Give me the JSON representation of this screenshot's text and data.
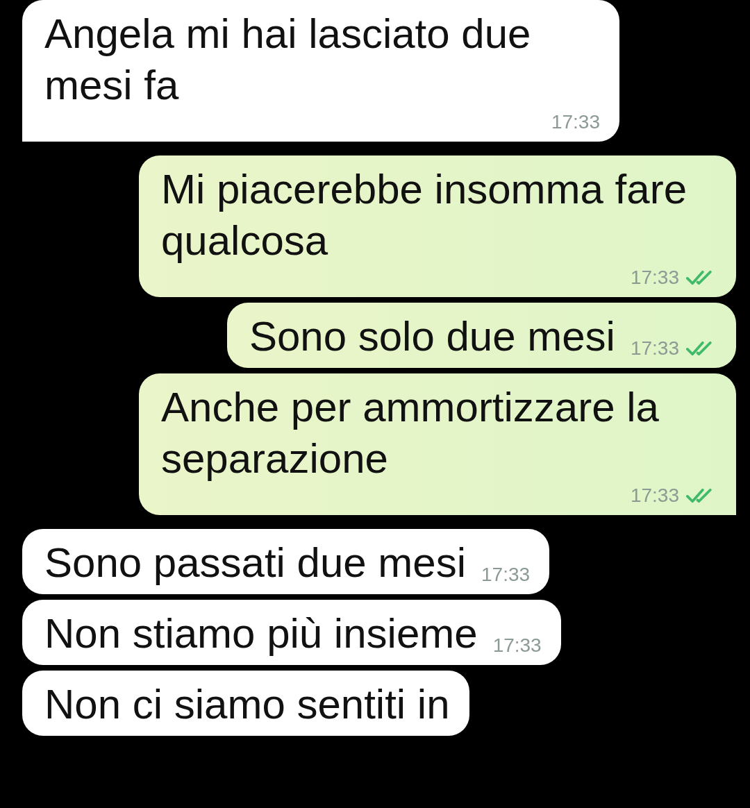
{
  "messages": [
    {
      "kind": "incoming",
      "text": "Angela mi hai lasciato due mesi fa",
      "time": "17:33",
      "tail": true
    },
    {
      "kind": "outgoing",
      "text": "Mi piacerebbe insomma fare qualcosa",
      "time": "17:33",
      "read": true,
      "tail": false
    },
    {
      "kind": "outgoing",
      "text": "Sono solo due mesi",
      "time": "17:33",
      "read": true,
      "tail": false
    },
    {
      "kind": "outgoing",
      "text": "Anche per ammortizzare la separazione",
      "time": "17:33",
      "read": true,
      "tail": true
    },
    {
      "kind": "incoming",
      "text": "Sono passati due mesi",
      "time": "17:33",
      "tail": false
    },
    {
      "kind": "incoming",
      "text": "Non stiamo più insieme",
      "time": "17:33",
      "tail": false
    },
    {
      "kind": "incoming",
      "text": "Non ci siamo sentiti in",
      "tail": false
    }
  ]
}
